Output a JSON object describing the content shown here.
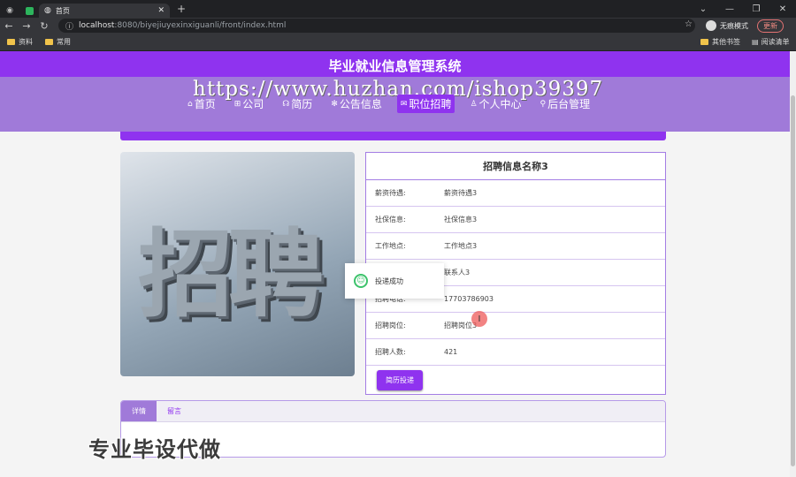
{
  "browser": {
    "tab_title": "首页",
    "new_tab_symbol": "+",
    "url_host": "localhost",
    "url_path": ":8080/biyejiuyexinxiguanli/front/index.html",
    "incognito_label": "无痕模式",
    "update_label": "更新",
    "bookmarks": [
      "资料",
      "常用"
    ],
    "bookmarks_right": [
      "其他书签",
      "阅读清单"
    ]
  },
  "site": {
    "title": "毕业就业信息管理系统",
    "watermark_url": "https://www.huzhan.com/ishop39397",
    "menu": [
      {
        "icon": "⌂",
        "label": "首页"
      },
      {
        "icon": "⊞",
        "label": "公司"
      },
      {
        "icon": "☊",
        "label": "简历"
      },
      {
        "icon": "✻",
        "label": "公告信息"
      },
      {
        "icon": "✉",
        "label": "职位招聘"
      },
      {
        "icon": "♙",
        "label": "个人中心"
      },
      {
        "icon": "⚲",
        "label": "后台管理"
      }
    ],
    "active_menu": "职位招聘"
  },
  "image_text": "招聘",
  "detail": {
    "title": "招聘信息名称3",
    "rows": [
      {
        "label": "薪资待遇:",
        "value": "薪资待遇3"
      },
      {
        "label": "社保信息:",
        "value": "社保信息3"
      },
      {
        "label": "工作地点:",
        "value": "工作地点3"
      },
      {
        "label": "",
        "value": "联系人3"
      },
      {
        "label": "招聘电话:",
        "value": "17703786903"
      },
      {
        "label": "招聘岗位:",
        "value": "招聘岗位3"
      },
      {
        "label": "招聘人数:",
        "value": "421"
      }
    ],
    "submit_label": "简历投递"
  },
  "toast": {
    "message": "投递成功"
  },
  "tabs": [
    "详情",
    "留言"
  ],
  "watermark_bottom": "专业毕设代做"
}
